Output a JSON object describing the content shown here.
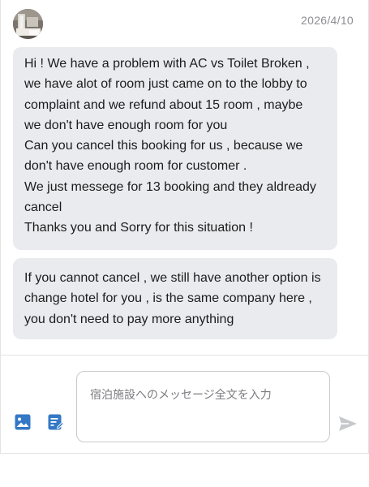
{
  "header": {
    "timestamp": "2026/4/10",
    "avatar_icon": "hotel-room-photo"
  },
  "messages": [
    {
      "lines": [
        "Hi ! We have a problem with AC vs Toilet Broken ,",
        "we have alot of room just came on to the lobby to",
        "complaint and we refund about 15 room , maybe",
        "we don't have enough room for you",
        "Can you cancel this booking for us , because we",
        "don't have enough room for customer .",
        "We just messege for 13 booking and they aldready",
        "cancel",
        "Thanks you and Sorry for this situation !"
      ]
    },
    {
      "lines": [
        "If you cannot cancel , we still have another option is",
        "change hotel for you , is the same company here ,",
        "you don't need to pay more anything"
      ]
    }
  ],
  "composer": {
    "placeholder": "宿泊施設へのメッセージ全文を入力",
    "value": "",
    "image_icon": "image-icon",
    "template_icon": "edit-note-icon",
    "send_icon": "send-icon"
  },
  "colors": {
    "accent": "#3478c6",
    "bubble_bg": "#eaebee",
    "timestamp": "#8e8e93",
    "send_disabled": "#c7c8cc"
  }
}
